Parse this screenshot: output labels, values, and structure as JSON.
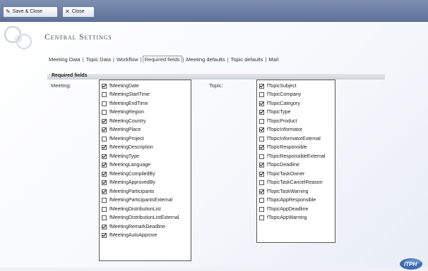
{
  "toolbar": {
    "save_close_label": "Save & Close",
    "close_label": "Close"
  },
  "page": {
    "title": "Central Settings"
  },
  "tabs": [
    {
      "label": "Meeting Data",
      "active": false
    },
    {
      "label": "Topic Data",
      "active": false
    },
    {
      "label": "Workflow",
      "active": false
    },
    {
      "label": "Required fields",
      "active": true
    },
    {
      "label": "Meeting defaults",
      "active": false
    },
    {
      "label": "Topic defaults",
      "active": false
    },
    {
      "label": "Mail",
      "active": false
    }
  ],
  "section": {
    "title": "Required fields"
  },
  "meeting": {
    "label": "Meeting:",
    "fields": [
      {
        "name": "fMeetingDate",
        "checked": true
      },
      {
        "name": "fMeetingStartTime",
        "checked": false
      },
      {
        "name": "fMeetingEndTime",
        "checked": false
      },
      {
        "name": "fMeetingRegion",
        "checked": false
      },
      {
        "name": "fMeetingCountry",
        "checked": true
      },
      {
        "name": "fMeetingPlace",
        "checked": true
      },
      {
        "name": "fMeetingProject",
        "checked": false
      },
      {
        "name": "fMeetingDescription",
        "checked": true
      },
      {
        "name": "fMeetingType",
        "checked": true
      },
      {
        "name": "fMeetingLanguage",
        "checked": true
      },
      {
        "name": "fMeetingCompiledBy",
        "checked": true
      },
      {
        "name": "fMeetingApprovedBy",
        "checked": true
      },
      {
        "name": "fMeetingParticipants",
        "checked": true
      },
      {
        "name": "fMeetingParticipantsExternal",
        "checked": false
      },
      {
        "name": "fMeetingDistributionList",
        "checked": false
      },
      {
        "name": "fMeetingDistributionListExternal",
        "checked": false
      },
      {
        "name": "fMeetingRemarkDeadline",
        "checked": true
      },
      {
        "name": "fMeetingAutoApprove",
        "checked": true
      }
    ]
  },
  "topic": {
    "label": "Topic:",
    "fields": [
      {
        "name": "fTopicSubject",
        "checked": true
      },
      {
        "name": "fTopicCompany",
        "checked": false
      },
      {
        "name": "fTopicCategory",
        "checked": true
      },
      {
        "name": "fTopicType",
        "checked": true
      },
      {
        "name": "fTopicProduct",
        "checked": false
      },
      {
        "name": "fTopicInformator",
        "checked": true
      },
      {
        "name": "fTopicInformatorExternal",
        "checked": false
      },
      {
        "name": "fTopicResponsible",
        "checked": true
      },
      {
        "name": "fTopicResponsibleExternal",
        "checked": false
      },
      {
        "name": "fTopicDeadline",
        "checked": true
      },
      {
        "name": "fTopicTaskOwner",
        "checked": true
      },
      {
        "name": "fTopicTaskCancelReason",
        "checked": false
      },
      {
        "name": "fTopicTaskWarning",
        "checked": true
      },
      {
        "name": "fTopicAppResponsible",
        "checked": false
      },
      {
        "name": "fTopicAppDeadline",
        "checked": false
      },
      {
        "name": "fTopicAppWarning",
        "checked": false
      }
    ]
  },
  "logo": {
    "text": "ITPH"
  },
  "colors": {
    "toolbar": "#6e80a6",
    "section_bar": "#d6d9de",
    "logo_blue": "#3e6bb0"
  }
}
